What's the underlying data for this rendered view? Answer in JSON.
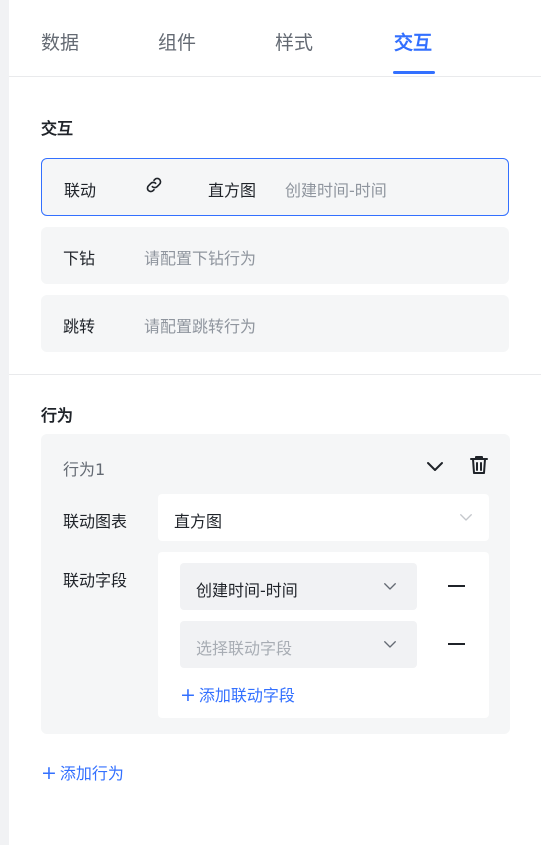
{
  "tabs": [
    {
      "label": "数据",
      "active": false
    },
    {
      "label": "组件",
      "active": false
    },
    {
      "label": "样式",
      "active": false
    },
    {
      "label": "交互",
      "active": true
    }
  ],
  "interaction": {
    "title": "交互",
    "rows": [
      {
        "label": "联动",
        "chart": "直方图",
        "field": "创建时间-时间",
        "icon": "link-icon",
        "selected": true
      },
      {
        "label": "下钻",
        "placeholder": "请配置下钻行为"
      },
      {
        "label": "跳转",
        "placeholder": "请配置跳转行为"
      }
    ]
  },
  "behavior": {
    "title": "行为",
    "items": [
      {
        "name": "行为1",
        "chart_label": "联动图表",
        "chart_value": "直方图",
        "field_label": "联动字段",
        "fields": [
          {
            "value": "创建时间-时间",
            "placeholder": false
          },
          {
            "value": "选择联动字段",
            "placeholder": true
          }
        ],
        "add_field_label": "添加联动字段"
      }
    ],
    "add_label": "添加行为"
  },
  "colors": {
    "accent": "#3370ff",
    "card_bg": "#f5f6f7",
    "text": "#1f2329",
    "muted": "#8f959e"
  }
}
